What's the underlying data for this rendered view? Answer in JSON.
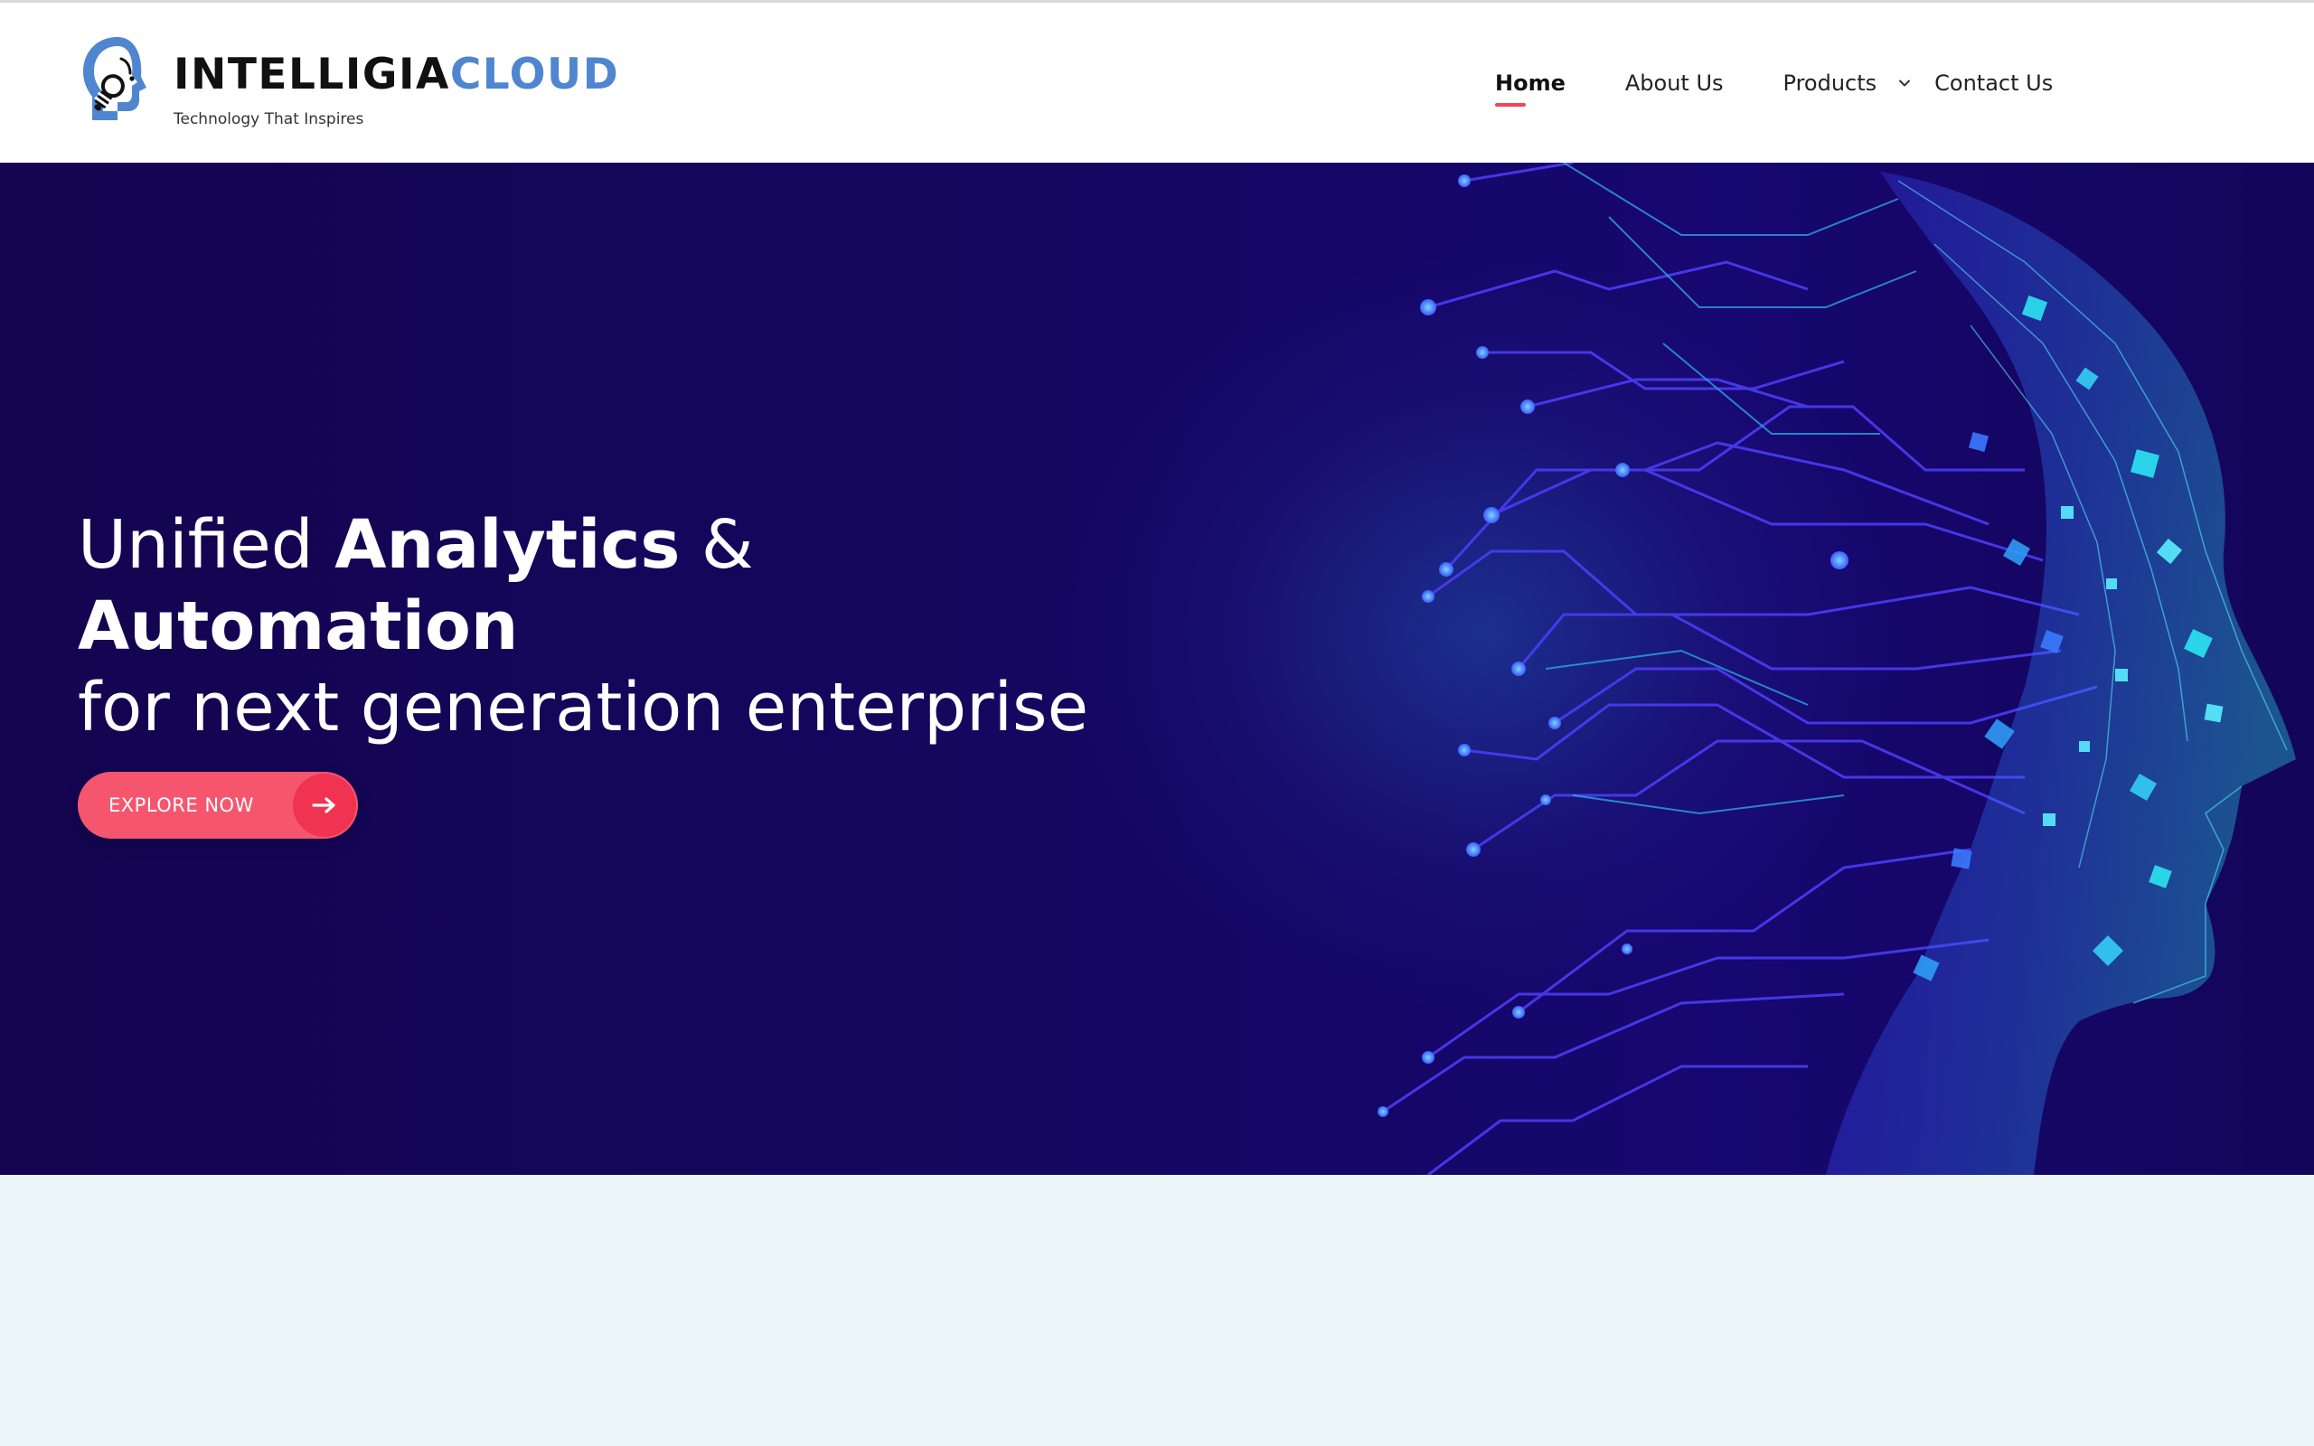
{
  "brand": {
    "name_part1": "INTELLIGIA",
    "name_part2": "CLOUD",
    "tagline": "Technology That Inspires",
    "logo_icon": "head-lightbulb-icon"
  },
  "nav": {
    "items": [
      {
        "label": "Home",
        "active": true
      },
      {
        "label": "About Us"
      },
      {
        "label": "Products",
        "has_dropdown": true
      },
      {
        "label": "Contact Us"
      }
    ]
  },
  "hero": {
    "line1_light": "Unified ",
    "line1_bold": "Analytics",
    "line1_tail": " &",
    "line2": "Automation",
    "line3": "for next generation enterprise",
    "cta_label": "EXPLORE NOW",
    "cta_icon": "arrow-right-icon",
    "art": "digital-circuit-head-illustration"
  },
  "colors": {
    "brand_dark": "#111111",
    "brand_accent": "#4f86cf",
    "nav_active_underline": "#f0445f",
    "hero_bg": "#150660",
    "cta_bg": "#f5566e",
    "cta_circle": "#ef3350",
    "page_bg": "#edf6f8"
  }
}
